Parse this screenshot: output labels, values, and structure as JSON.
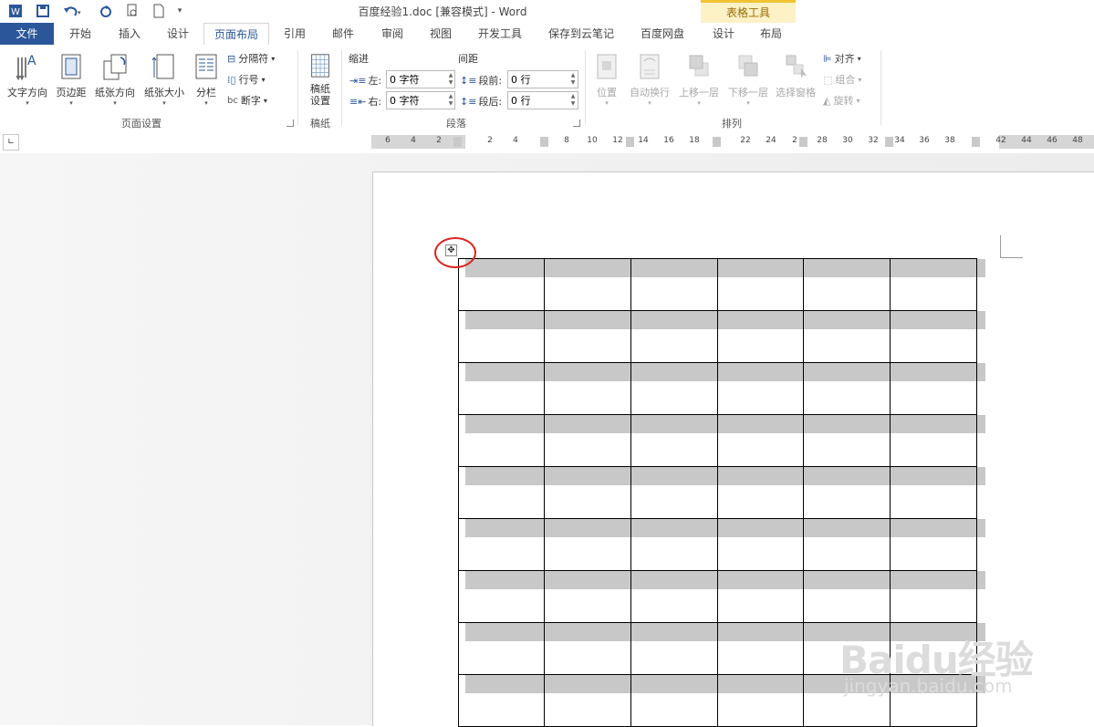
{
  "window": {
    "title": "百度经验1.doc [兼容模式] - Word",
    "context_group": "表格工具"
  },
  "tabs": [
    "文件",
    "开始",
    "插入",
    "设计",
    "页面布局",
    "引用",
    "邮件",
    "审阅",
    "视图",
    "开发工具",
    "保存到云笔记",
    "百度网盘",
    "设计",
    "布局"
  ],
  "active_tab": "页面布局",
  "ribbon": {
    "page_setup": {
      "text_direction": "文字方向",
      "margins": "页边距",
      "orientation": "纸张方向",
      "size": "纸张大小",
      "columns": "分栏",
      "breaks": "分隔符",
      "line_numbers": "行号",
      "hyphenation": "断字",
      "group_label": "页面设置"
    },
    "draft": {
      "button_line1": "稿纸",
      "button_line2": "设置",
      "group_label": "稿纸"
    },
    "paragraph": {
      "indent_label": "缩进",
      "spacing_label": "间距",
      "left_label": "左:",
      "right_label": "右:",
      "before_label": "段前:",
      "after_label": "段后:",
      "left_value": "0 字符",
      "right_value": "0 字符",
      "before_value": "0 行",
      "after_value": "0 行",
      "group_label": "段落"
    },
    "arrange": {
      "position": "位置",
      "wrap_text": "自动换行",
      "bring_forward": "上移一层",
      "send_backward": "下移一层",
      "selection_pane": "选择窗格",
      "align": "对齐",
      "group": "组合",
      "rotate": "旋转",
      "group_label": "排列"
    }
  },
  "ruler": {
    "ticks": [
      "6",
      "4",
      "2",
      "2",
      "4",
      "8",
      "10",
      "12",
      "14",
      "16",
      "18",
      "22",
      "24",
      "2",
      "28",
      "30",
      "32",
      "34",
      "36",
      "38",
      "42",
      "44",
      "46",
      "48"
    ]
  },
  "table": {
    "rows": 9,
    "cols": 6
  },
  "watermark": {
    "line1": "Baidu经验",
    "line2": "jingyan.baidu.com"
  },
  "colors": {
    "accent": "#2b579a",
    "context": "#f1c232",
    "highlight_circle": "#e02020"
  }
}
